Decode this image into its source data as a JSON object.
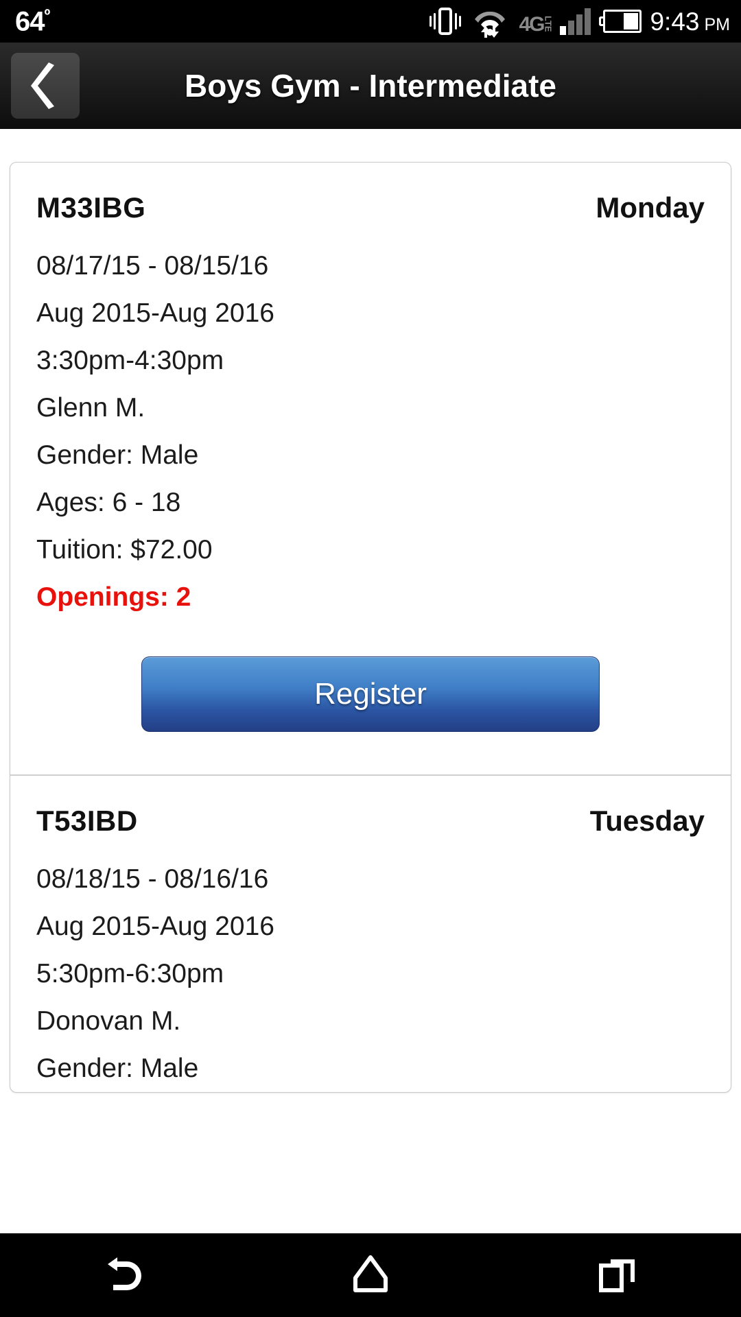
{
  "status_bar": {
    "temperature": "64",
    "degree_symbol": "º",
    "icons": [
      "vibrate-icon",
      "wifi-icon",
      "4g-lte-icon",
      "signal-bars-icon",
      "battery-icon"
    ],
    "network_label": "4G",
    "network_sublabel": "LTE",
    "battery_level_percent": 42,
    "time": "9:43",
    "meridiem": "PM"
  },
  "title_bar": {
    "back_icon": "back-chevron-icon",
    "title": "Boys Gym - Intermediate"
  },
  "classes": [
    {
      "code": "M33IBG",
      "day": "Monday",
      "date_range": "08/17/15 - 08/15/16",
      "session": "Aug 2015-Aug 2016",
      "time": "3:30pm-4:30pm",
      "instructor": "Glenn M.",
      "gender": "Gender: Male",
      "ages": "Ages: 6 - 18",
      "tuition": "Tuition: $72.00",
      "openings": "Openings: 2",
      "register_label": "Register"
    },
    {
      "code": "T53IBD",
      "day": "Tuesday",
      "date_range": "08/18/15 - 08/16/16",
      "session": "Aug 2015-Aug 2016",
      "time": "5:30pm-6:30pm",
      "instructor": "Donovan M.",
      "gender": "Gender: Male"
    }
  ],
  "nav_bar": {
    "back_icon": "nav-back-icon",
    "home_icon": "nav-home-icon",
    "recents_icon": "nav-recents-icon"
  },
  "colors": {
    "openings_red": "#e8120c",
    "register_blue_top": "#5a9bd8",
    "register_blue_bottom": "#233f86",
    "status_bar_bg": "#000000"
  }
}
